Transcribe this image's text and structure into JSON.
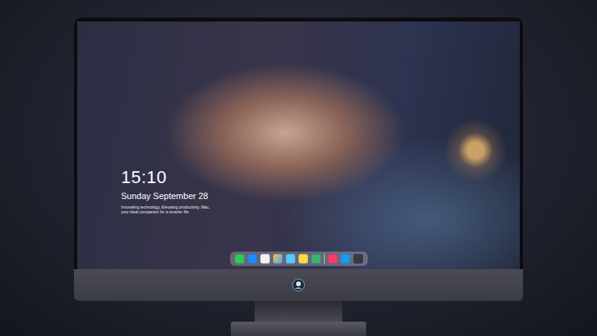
{
  "lock_screen": {
    "time": "15:10",
    "date": "Sunday September 28",
    "tagline": [
      "Innovating technology, Elevating productivity. Mac,",
      "your ideal companion for a smarter life."
    ]
  }
}
